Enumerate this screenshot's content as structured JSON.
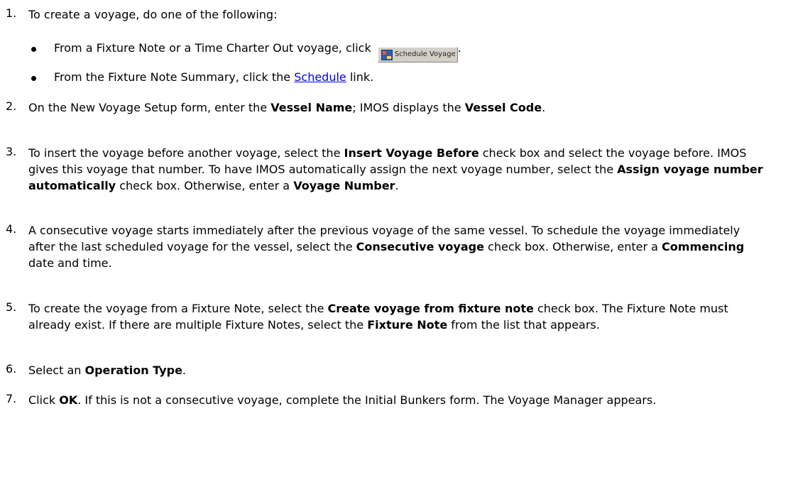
{
  "steps": [
    {
      "number": "1.",
      "intro": "To create a voyage, do one of the following:",
      "bullets": [
        {
          "before": "From a Fixture Note or a Time Charter Out voyage, click ",
          "button_label": "Schedule Voyage",
          "after": "."
        },
        {
          "before": "From the Fixture Note Summary, click the ",
          "link": "Schedule",
          "after": " link."
        }
      ]
    },
    {
      "number": "2.",
      "parts": [
        "On the New Voyage Setup form, enter the ",
        "Vessel Name",
        "; IMOS displays the ",
        "Vessel Code",
        "."
      ]
    },
    {
      "number": "3.",
      "parts": [
        "To insert the voyage before another voyage, select the ",
        "Insert Voyage Before",
        " check box and select the voyage before. IMOS gives this voyage that number. To have IMOS automatically assign the next voyage number, select the ",
        "Assign voyage number automatically",
        " check box. Otherwise, enter a ",
        "Voyage Number",
        "."
      ]
    },
    {
      "number": "4.",
      "parts": [
        "A consecutive voyage starts immediately after the previous voyage of the same vessel. To schedule the voyage immediately after the last scheduled voyage for the vessel, select the ",
        "Consecutive voyage",
        " check box. Otherwise, enter a ",
        "Commencing",
        " date and time."
      ]
    },
    {
      "number": "5.",
      "parts": [
        "To create the voyage from a Fixture Note, select the ",
        "Create voyage from fixture note",
        " check box. The Fixture Note must already exist. If there are multiple Fixture Notes, select the ",
        "Fixture Note",
        " from the list that appears."
      ]
    },
    {
      "number": "6.",
      "parts": [
        "Select an ",
        "Operation Type",
        "."
      ]
    },
    {
      "number": "7.",
      "parts": [
        "Click ",
        "OK",
        ". If this is not a consecutive voyage, complete the Initial Bunkers form. The Voyage Manager appears."
      ]
    }
  ]
}
